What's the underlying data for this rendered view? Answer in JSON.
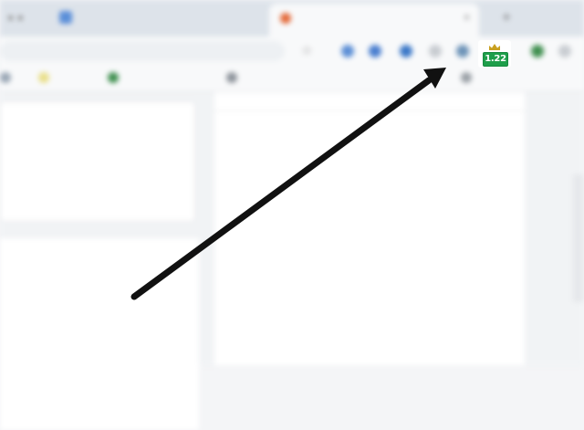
{
  "browser": {
    "tabs": [
      {
        "label": ""
      },
      {
        "label": ""
      }
    ],
    "address_bar": {
      "value": ""
    }
  },
  "bookmarks": [
    "",
    "",
    "",
    "",
    ""
  ],
  "extension": {
    "badge_text": "1.22",
    "icon": "crown-icon",
    "badge_color": "#1e9e4a",
    "crown_color": "#c9a020"
  },
  "annotation": {
    "type": "arrow",
    "color": "#111111",
    "points_to": "extension-badge"
  }
}
